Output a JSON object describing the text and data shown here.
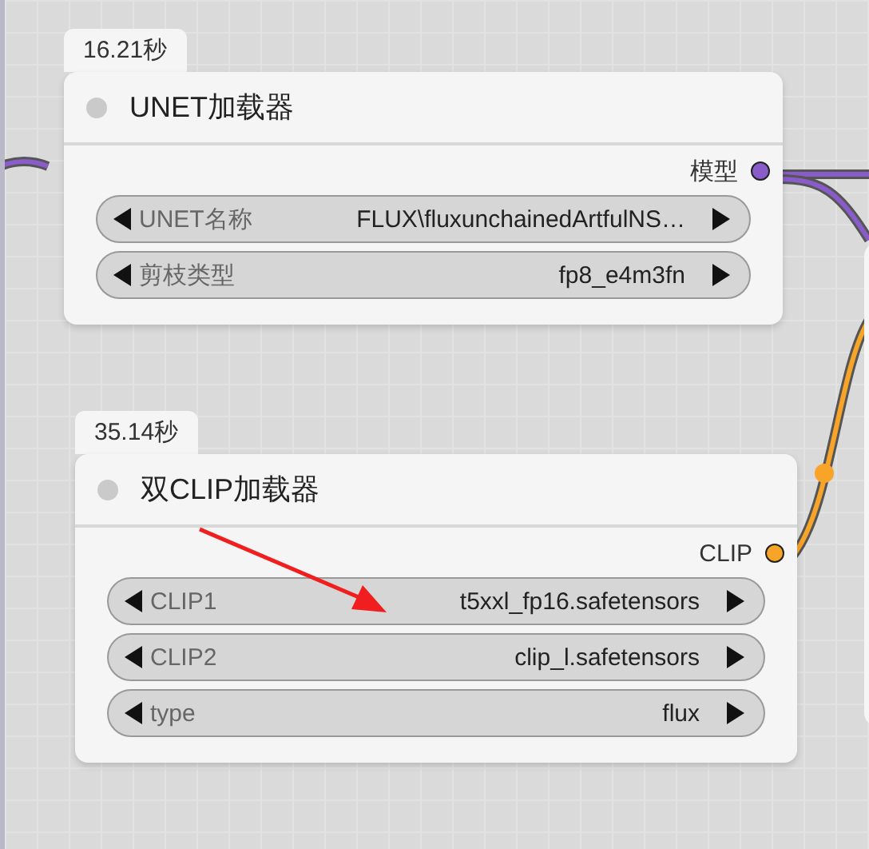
{
  "nodes": [
    {
      "time": "16.21秒",
      "title": "UNET加载器",
      "outputs": [
        {
          "label": "模型",
          "color": "#8a5cc9"
        }
      ],
      "widgets": [
        {
          "label": "UNET名称",
          "value": "FLUX\\fluxunchainedArtfulNS…"
        },
        {
          "label": "剪枝类型",
          "value": "fp8_e4m3fn"
        }
      ]
    },
    {
      "time": "35.14秒",
      "title": "双CLIP加载器",
      "outputs": [
        {
          "label": "CLIP",
          "color": "#f7a428"
        }
      ],
      "widgets": [
        {
          "label": "CLIP1",
          "value": "t5xxl_fp16.safetensors"
        },
        {
          "label": "CLIP2",
          "value": "clip_l.safetensors"
        },
        {
          "label": "type",
          "value": "flux"
        }
      ]
    }
  ]
}
